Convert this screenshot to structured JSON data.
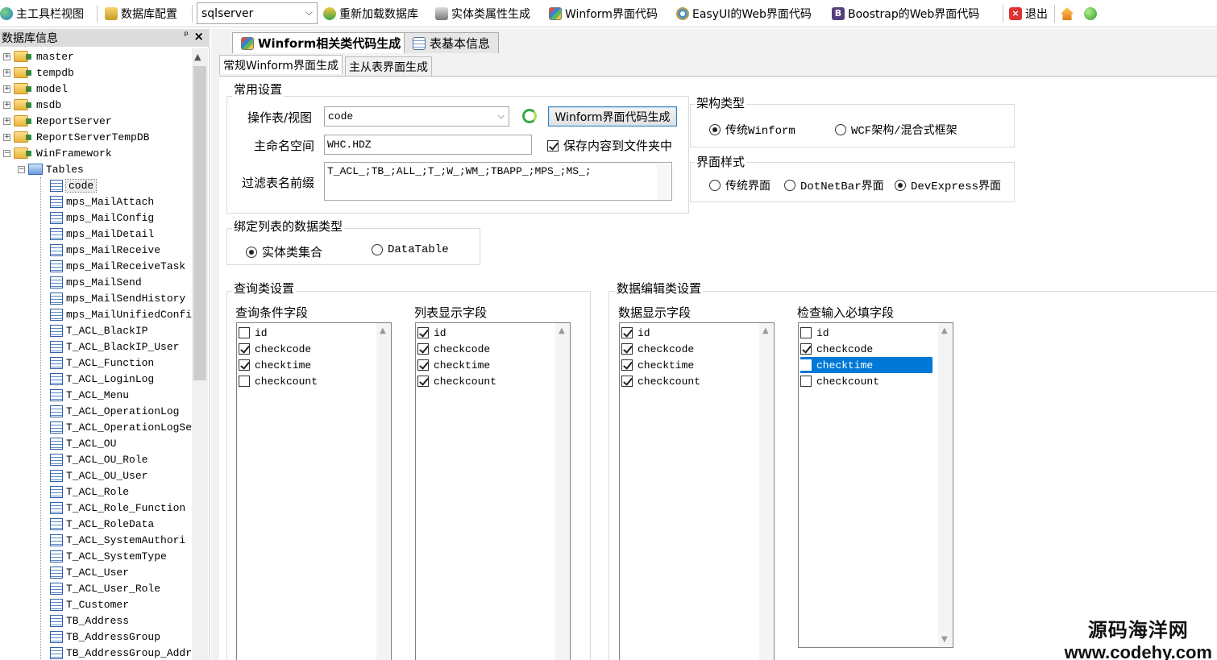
{
  "toolbar": {
    "items": [
      {
        "label": "主工具栏视图",
        "icon": "globe-icon"
      },
      {
        "label": "数据库配置",
        "icon": "database-config-icon"
      },
      {
        "label": "重新加载数据库",
        "icon": "reload-icon"
      },
      {
        "label": "实体类属性生成",
        "icon": "entity-generate-icon"
      },
      {
        "label": "Winform界面代码",
        "icon": "winform-icon"
      },
      {
        "label": "EasyUI的Web界面代码",
        "icon": "easyui-icon"
      },
      {
        "label": "Boostrap的Web界面代码",
        "icon": "bootstrap-icon"
      },
      {
        "label": "退出",
        "icon": "exit-icon"
      }
    ],
    "db_select_value": "sqlserver",
    "bootstrap_glyph": "B",
    "exit_glyph": "×"
  },
  "left_panel": {
    "title": "数据库信息",
    "pin_glyph": "ᵖ",
    "close_glyph": "×",
    "databases": [
      "master",
      "tempdb",
      "model",
      "msdb",
      "ReportServer",
      "ReportServerTempDB",
      "WinFramework"
    ],
    "tables_label": "Tables",
    "tables": [
      "code",
      "mps_MailAttach",
      "mps_MailConfig",
      "mps_MailDetail",
      "mps_MailReceive",
      "mps_MailReceiveTask",
      "mps_MailSend",
      "mps_MailSendHistory",
      "mps_MailUnifiedConfi",
      "T_ACL_BlackIP",
      "T_ACL_BlackIP_User",
      "T_ACL_Function",
      "T_ACL_LoginLog",
      "T_ACL_Menu",
      "T_ACL_OperationLog",
      "T_ACL_OperationLogSe",
      "T_ACL_OU",
      "T_ACL_OU_Role",
      "T_ACL_OU_User",
      "T_ACL_Role",
      "T_ACL_Role_Function",
      "T_ACL_RoleData",
      "T_ACL_SystemAuthori",
      "T_ACL_SystemType",
      "T_ACL_User",
      "T_ACL_User_Role",
      "T_Customer",
      "TB_Address",
      "TB_AddressGroup",
      "TB_AddressGroup_Addr"
    ]
  },
  "tabs": {
    "main": [
      {
        "label": "Winform相关类代码生成",
        "active": true
      },
      {
        "label": "表基本信息",
        "active": false
      }
    ],
    "sub": [
      {
        "label": "常规Winform界面生成",
        "active": true
      },
      {
        "label": "主从表界面生成",
        "active": false
      }
    ]
  },
  "common": {
    "title": "常用设置",
    "table_label": "操作表/视图",
    "table_value": "code",
    "generate_button": "Winform界面代码生成",
    "namespace_label": "主命名空间",
    "namespace_value": "WHC.HDZ",
    "save_to_folder_label": "保存内容到文件夹中",
    "save_to_folder_checked": true,
    "filter_label": "过滤表名前缀",
    "filter_value": "T_ACL_;TB_;ALL_;T_;W_;WM_;TBAPP_;MPS_;MS_;"
  },
  "architecture": {
    "title": "架构类型",
    "options": [
      "传统Winform",
      "WCF架构/混合式框架"
    ],
    "selected": 0
  },
  "ui_style": {
    "title": "界面样式",
    "options": [
      "传统界面",
      "DotNetBar界面",
      "DevExpress界面"
    ],
    "selected": 2
  },
  "binding": {
    "title": "绑定列表的数据类型",
    "options": [
      "实体类集合",
      "DataTable"
    ],
    "selected": 0
  },
  "query_settings": {
    "title": "查询类设置",
    "lists": [
      {
        "title": "查询条件字段",
        "items": [
          {
            "label": "id",
            "checked": false
          },
          {
            "label": "checkcode",
            "checked": true
          },
          {
            "label": "checktime",
            "checked": true
          },
          {
            "label": "checkcount",
            "checked": false
          }
        ]
      },
      {
        "title": "列表显示字段",
        "items": [
          {
            "label": "id",
            "checked": true
          },
          {
            "label": "checkcode",
            "checked": true
          },
          {
            "label": "checktime",
            "checked": true
          },
          {
            "label": "checkcount",
            "checked": true
          }
        ]
      }
    ]
  },
  "edit_settings": {
    "title": "数据编辑类设置",
    "lists": [
      {
        "title": "数据显示字段",
        "items": [
          {
            "label": "id",
            "checked": true
          },
          {
            "label": "checkcode",
            "checked": true
          },
          {
            "label": "checktime",
            "checked": true
          },
          {
            "label": "checkcount",
            "checked": true
          }
        ]
      },
      {
        "title": "检查输入必填字段",
        "items": [
          {
            "label": "id",
            "checked": false
          },
          {
            "label": "checkcode",
            "checked": true
          },
          {
            "label": "checktime",
            "checked": false,
            "selected": true
          },
          {
            "label": "checkcount",
            "checked": false
          }
        ]
      }
    ]
  },
  "watermark": {
    "line1": "源码海洋网",
    "line2": "www.codehy.com"
  },
  "colors": {
    "selection": "#0078d7",
    "panel_header": "#dcdcdc",
    "button_border": "#3c7fb1"
  }
}
